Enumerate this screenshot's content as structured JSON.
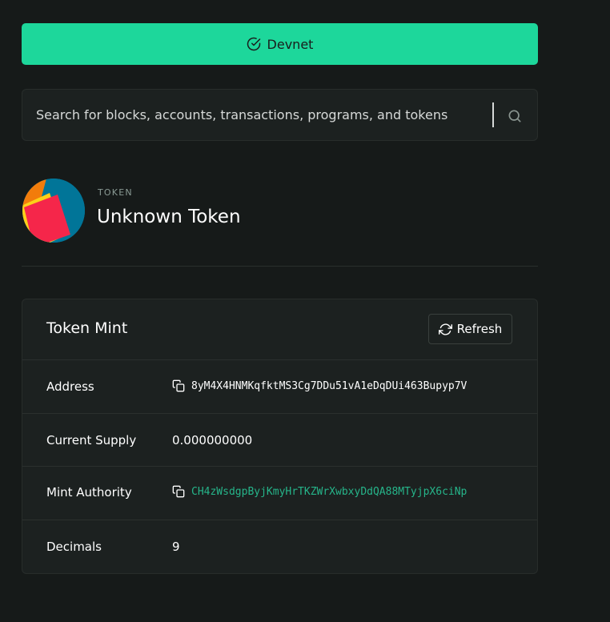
{
  "cluster": {
    "label": "Devnet",
    "color": "#1dd79b",
    "icon": "check-circle-icon"
  },
  "search": {
    "placeholder": "Search for blocks, accounts, transactions, programs, and tokens",
    "icon": "search-icon"
  },
  "token_header": {
    "label": "TOKEN",
    "name": "Unknown Token",
    "avatar": "identicon-avatar"
  },
  "card": {
    "title": "Token Mint",
    "refresh_label": "Refresh",
    "rows": [
      {
        "label": "Address",
        "value": "8yM4X4HNMKqfktMS3Cg7DDu51vA1eDqDUi463Bupyp7V",
        "copy": true,
        "link": false
      },
      {
        "label": "Current Supply",
        "value": "0.000000000",
        "copy": false,
        "link": false
      },
      {
        "label": "Mint Authority",
        "value": "CH4zWsdgpByjKmyHrTKZWrXwbxyDdQA88MTyjpX6ciNp",
        "copy": true,
        "link": true
      },
      {
        "label": "Decimals",
        "value": "9",
        "copy": false,
        "link": false
      }
    ]
  },
  "colors": {
    "background": "#161a19",
    "accent": "#1dd79b",
    "link": "#26b58a"
  }
}
